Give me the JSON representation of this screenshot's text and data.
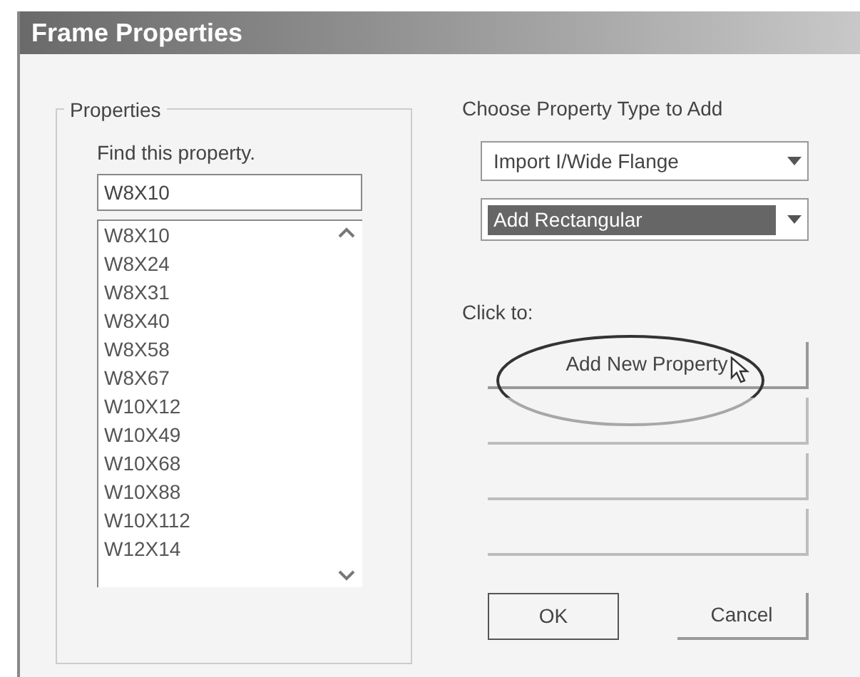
{
  "window": {
    "title": "Frame Properties"
  },
  "properties": {
    "group_label": "Properties",
    "find_label": "Find this property.",
    "find_value": "W8X10",
    "list": [
      {
        "label": "W8X10",
        "selected": false
      },
      {
        "label": "W8X24",
        "selected": false
      },
      {
        "label": "W8X31",
        "selected": false
      },
      {
        "label": "W8X40",
        "selected": false
      },
      {
        "label": "W8X58",
        "selected": false
      },
      {
        "label": "W8X67",
        "selected": false
      },
      {
        "label": "W10X12",
        "selected": false
      },
      {
        "label": "W10X49",
        "selected": false
      },
      {
        "label": "W10X68",
        "selected": false
      },
      {
        "label": "W10X88",
        "selected": false
      },
      {
        "label": "W10X112",
        "selected": false
      },
      {
        "label": "W12X14",
        "selected": false
      }
    ]
  },
  "add_type": {
    "group_label": "Choose Property Type to Add",
    "import_dropdown": {
      "value": "Import I/Wide Flange",
      "selected": false
    },
    "add_dropdown": {
      "value": "Add Rectangular",
      "selected": true
    }
  },
  "click_to": {
    "label": "Click to:",
    "buttons": [
      {
        "label": "Add New Property",
        "highlighted": true
      },
      {
        "disabled": true
      },
      {
        "disabled": true
      },
      {
        "disabled": true
      }
    ]
  },
  "buttons": [
    "OK",
    "Cancel"
  ]
}
